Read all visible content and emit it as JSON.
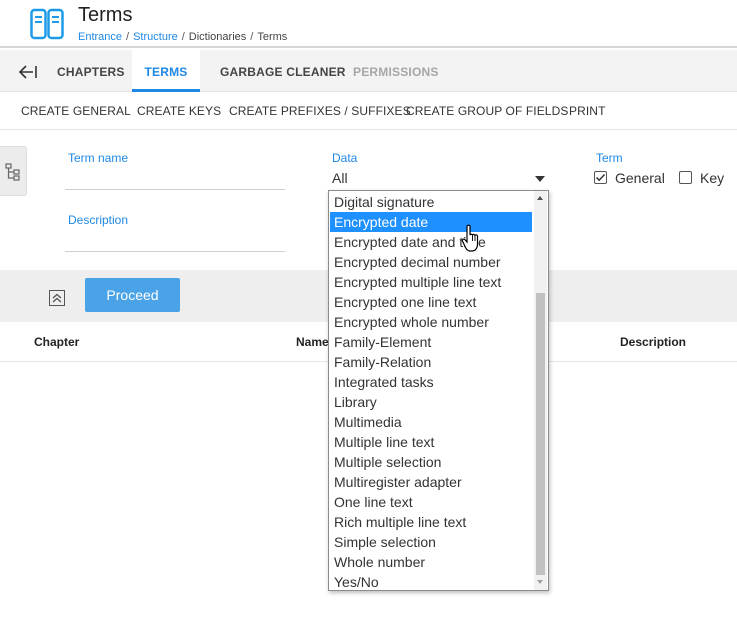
{
  "header": {
    "title": "Terms",
    "breadcrumb": [
      "Entrance",
      "Structure",
      "Dictionaries",
      "Terms"
    ]
  },
  "tabs": [
    {
      "label": "CHAPTERS",
      "state": "normal"
    },
    {
      "label": "TERMS",
      "state": "active"
    },
    {
      "label": "GARBAGE CLEANER",
      "state": "normal"
    },
    {
      "label": "PERMISSIONS",
      "state": "disabled"
    }
  ],
  "actions": [
    "CREATE GENERAL",
    "CREATE KEYS",
    "CREATE PREFIXES / SUFFIXES",
    "CREATE GROUP OF FIELDS",
    "PRINT"
  ],
  "filters": {
    "term_name_label": "Term name",
    "description_label": "Description",
    "data_label": "Data",
    "data_value": "All",
    "term_label": "Term",
    "term_options": [
      {
        "label": "General",
        "checked": true
      },
      {
        "label": "Key",
        "checked": false
      }
    ]
  },
  "proceed": {
    "label": "Proceed"
  },
  "table": {
    "columns": [
      "Chapter",
      "Name",
      "Description"
    ]
  },
  "dropdown": {
    "items": [
      "Digital signature",
      "Encrypted date",
      "Encrypted date and time",
      "Encrypted decimal number",
      "Encrypted multiple line text",
      "Encrypted one line text",
      "Encrypted whole number",
      "Family-Element",
      "Family-Relation",
      "Integrated tasks",
      "Library",
      "Multimedia",
      "Multiple line text",
      "Multiple selection",
      "Multiregister adapter",
      "One line text",
      "Rich multiple line text",
      "Simple selection",
      "Whole number",
      "Yes/No"
    ],
    "selected_index": 1
  },
  "colors": {
    "accent": "#1e88e5",
    "proceed": "#4aa3e6",
    "selection": "#1e90ff"
  }
}
